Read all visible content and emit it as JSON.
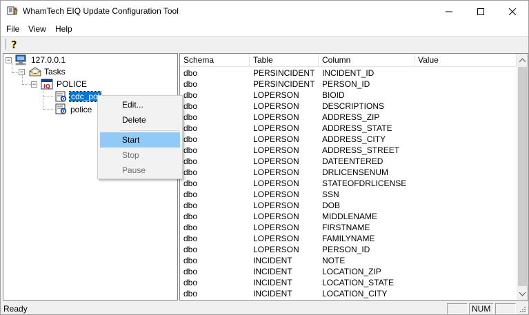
{
  "window": {
    "title": "WhamTech EIQ Update Configuration Tool",
    "minimize_icon": "minimize-icon",
    "maximize_icon": "maximize-icon",
    "close_icon": "close-icon"
  },
  "menu": {
    "items": [
      {
        "label": "File"
      },
      {
        "label": "View"
      },
      {
        "label": "Help"
      }
    ]
  },
  "toolbar": {
    "help_icon": "help-question-icon",
    "help_glyph": "?"
  },
  "tree": {
    "root": {
      "label": "127.0.0.1",
      "icon": "computer-icon"
    },
    "tasks": {
      "label": "Tasks",
      "icon": "tasks-folder-icon"
    },
    "police": {
      "label": "POLICE",
      "icon": "database-icon"
    },
    "children": [
      {
        "label": "cdc_pol",
        "icon": "task-config-icon",
        "selected": true
      },
      {
        "label": "police",
        "icon": "task-config-icon",
        "selected": false
      }
    ]
  },
  "list": {
    "columns": [
      "Schema",
      "Table",
      "Column",
      "Value"
    ],
    "rows": [
      [
        "dbo",
        "PERSINCIDENT",
        "INCIDENT_ID"
      ],
      [
        "dbo",
        "PERSINCIDENT",
        "PERSON_ID"
      ],
      [
        "dbo",
        "LOPERSON",
        "BIOID"
      ],
      [
        "dbo",
        "LOPERSON",
        "DESCRIPTIONS"
      ],
      [
        "dbo",
        "LOPERSON",
        "ADDRESS_ZIP"
      ],
      [
        "dbo",
        "LOPERSON",
        "ADDRESS_STATE"
      ],
      [
        "dbo",
        "LOPERSON",
        "ADDRESS_CITY"
      ],
      [
        "dbo",
        "LOPERSON",
        "ADDRESS_STREET"
      ],
      [
        "dbo",
        "LOPERSON",
        "DATEENTERED"
      ],
      [
        "dbo",
        "LOPERSON",
        "DRLICENSENUM"
      ],
      [
        "dbo",
        "LOPERSON",
        "STATEOFDRLICENSE"
      ],
      [
        "dbo",
        "LOPERSON",
        "SSN"
      ],
      [
        "dbo",
        "LOPERSON",
        "DOB"
      ],
      [
        "dbo",
        "LOPERSON",
        "MIDDLENAME"
      ],
      [
        "dbo",
        "LOPERSON",
        "FIRSTNAME"
      ],
      [
        "dbo",
        "LOPERSON",
        "FAMILYNAME"
      ],
      [
        "dbo",
        "LOPERSON",
        "PERSON_ID"
      ],
      [
        "dbo",
        "INCIDENT",
        "NOTE"
      ],
      [
        "dbo",
        "INCIDENT",
        "LOCATION_ZIP"
      ],
      [
        "dbo",
        "INCIDENT",
        "LOCATION_STATE"
      ],
      [
        "dbo",
        "INCIDENT",
        "LOCATION_CITY"
      ]
    ]
  },
  "context_menu": {
    "items": [
      {
        "label": "Edit...",
        "enabled": true,
        "highlighted": false
      },
      {
        "label": "Delete",
        "enabled": true,
        "highlighted": false
      },
      {
        "label": "Start",
        "enabled": true,
        "highlighted": true
      },
      {
        "label": "Stop",
        "enabled": false,
        "highlighted": false
      },
      {
        "label": "Pause",
        "enabled": false,
        "highlighted": false
      }
    ]
  },
  "statusbar": {
    "text": "Ready",
    "num_indicator": "NUM"
  },
  "colors": {
    "selection": "#0078d7",
    "menu_highlight": "#91c9f7"
  }
}
